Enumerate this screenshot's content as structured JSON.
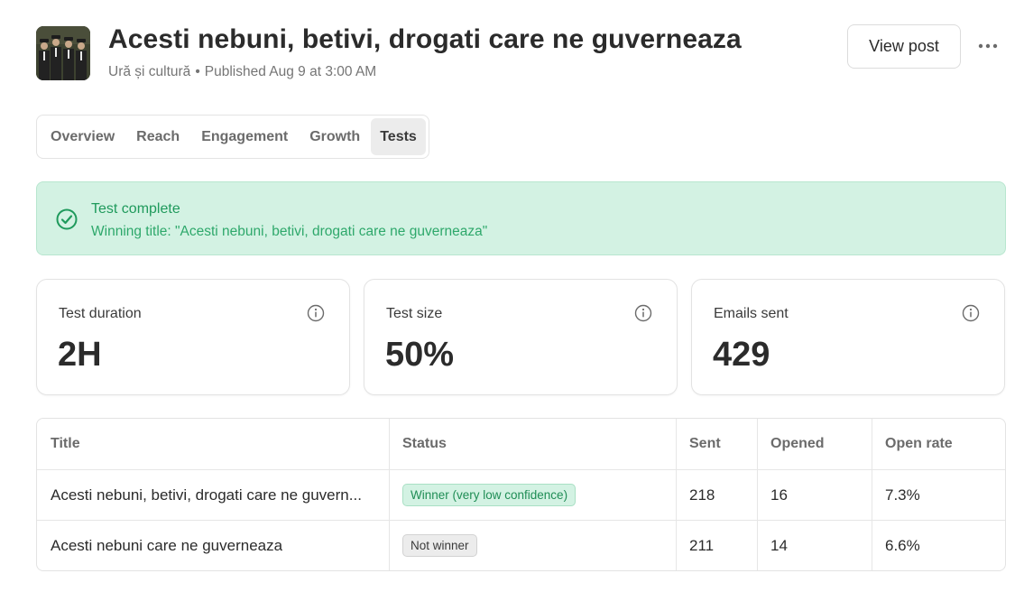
{
  "post": {
    "title": "Acesti nebuni, betivi, drogati care ne guverneaza",
    "publication": "Ură și cultură",
    "published": "Published Aug 9 at 3:00 AM",
    "view_post_label": "View post"
  },
  "tabs": [
    {
      "label": "Overview"
    },
    {
      "label": "Reach"
    },
    {
      "label": "Engagement"
    },
    {
      "label": "Growth"
    },
    {
      "label": "Tests",
      "active": true
    }
  ],
  "banner": {
    "title": "Test complete",
    "subtitle": "Winning title: \"Acesti nebuni, betivi, drogati care ne guverneaza\""
  },
  "stats": [
    {
      "label": "Test duration",
      "value": "2H"
    },
    {
      "label": "Test size",
      "value": "50%"
    },
    {
      "label": "Emails sent",
      "value": "429"
    }
  ],
  "table": {
    "columns": [
      "Title",
      "Status",
      "Sent",
      "Opened",
      "Open rate"
    ],
    "rows": [
      {
        "title": "Acesti nebuni, betivi, drogati care ne guvern...",
        "status": "Winner (very low confidence)",
        "status_type": "winner",
        "sent": "218",
        "opened": "16",
        "open_rate": "7.3%"
      },
      {
        "title": "Acesti nebuni care ne guverneaza",
        "status": "Not winner",
        "status_type": "not-winner",
        "sent": "211",
        "opened": "14",
        "open_rate": "6.6%"
      }
    ]
  },
  "colors": {
    "success_bg": "#d3f2e3",
    "success_text": "#1f9a5c",
    "border": "#e3e3e3"
  }
}
